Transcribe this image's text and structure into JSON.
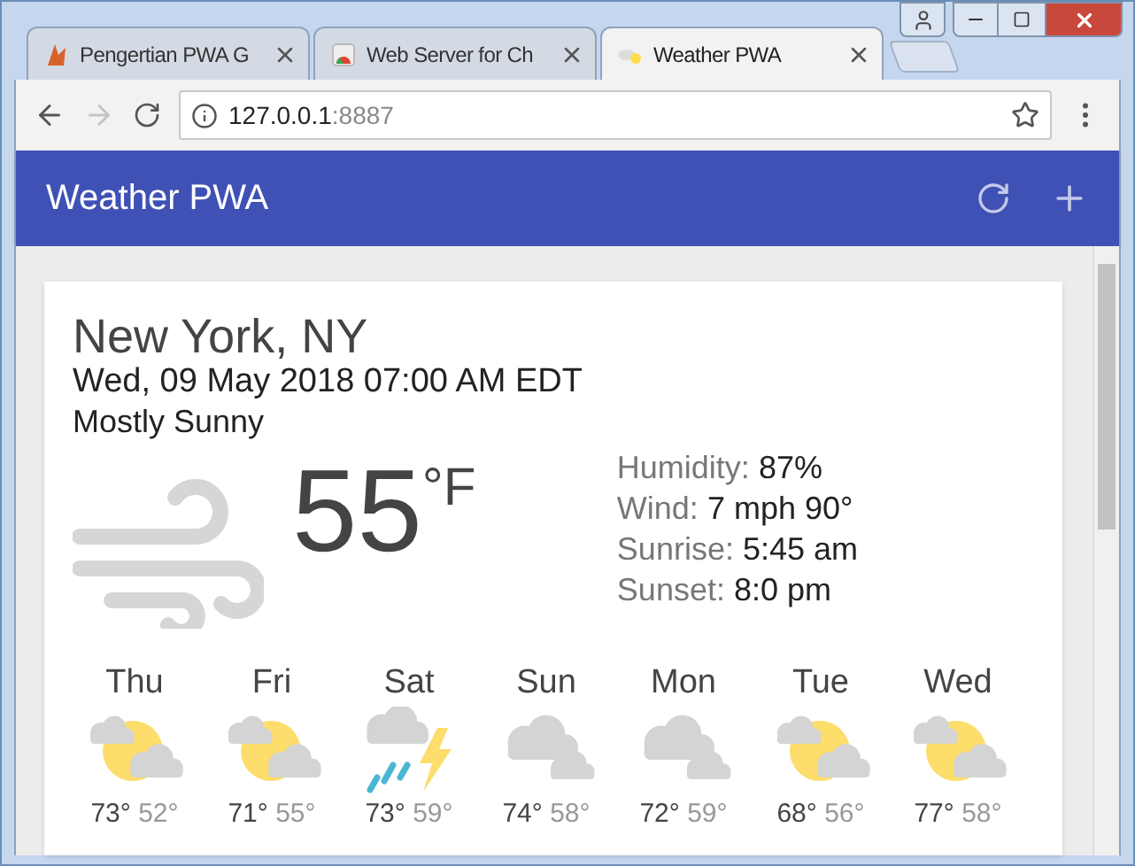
{
  "tabs": [
    {
      "title": "Pengertian PWA G",
      "kind": "logo",
      "selected": false
    },
    {
      "title": "Web Server for Ch",
      "kind": "app",
      "selected": false
    },
    {
      "title": "Weather PWA",
      "kind": "weather",
      "selected": true
    }
  ],
  "toolbar": {
    "forward_disabled": true,
    "address": {
      "host": "127.0.0.1",
      "port": ":8887"
    }
  },
  "app_header": {
    "title": "Weather PWA"
  },
  "card": {
    "location": "New York, NY",
    "date": "Wed, 09 May 2018 07:00 AM EDT",
    "description": "Mostly Sunny",
    "kind": "wind",
    "temperature": "55",
    "unit": "°F",
    "details": [
      {
        "label": "Humidity:",
        "value": "87%"
      },
      {
        "label": "Wind:",
        "value": "7 mph 90°"
      },
      {
        "label": "Sunrise:",
        "value": "5:45 am"
      },
      {
        "label": "Sunset:",
        "value": "8:0 pm"
      }
    ],
    "forecast": [
      {
        "day": "Thu",
        "kind": "partly-cloudy",
        "high": "73°",
        "low": "52°"
      },
      {
        "day": "Fri",
        "kind": "partly-cloudy",
        "high": "71°",
        "low": "55°"
      },
      {
        "day": "Sat",
        "kind": "thunderstorms",
        "high": "73°",
        "low": "59°"
      },
      {
        "day": "Sun",
        "kind": "cloudy",
        "high": "74°",
        "low": "58°"
      },
      {
        "day": "Mon",
        "kind": "cloudy",
        "high": "72°",
        "low": "59°"
      },
      {
        "day": "Tue",
        "kind": "partly-cloudy",
        "high": "68°",
        "low": "56°"
      },
      {
        "day": "Wed",
        "kind": "partly-cloudy",
        "high": "77°",
        "low": "58°"
      }
    ]
  }
}
